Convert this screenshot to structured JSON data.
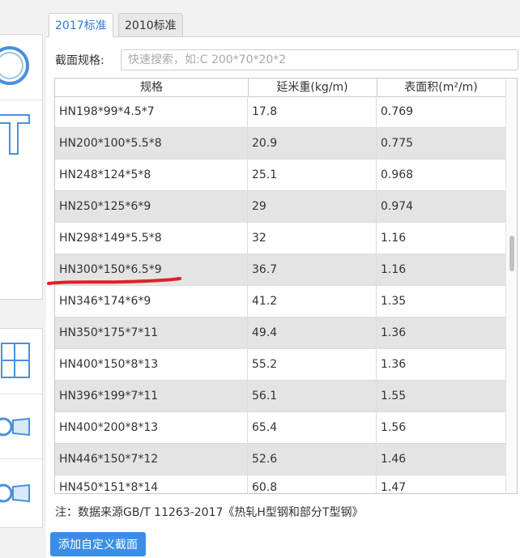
{
  "tabs": [
    {
      "label": "2017标准",
      "active": true
    },
    {
      "label": "2010标准",
      "active": false
    }
  ],
  "search": {
    "label": "截面规格:",
    "placeholder": "快速搜索，如:C 200*70*20*2",
    "value": ""
  },
  "table": {
    "headers": [
      "规格",
      "延米重(kg/m)",
      "表面积(m²/m)"
    ],
    "rows": [
      [
        "HN198*99*4.5*7",
        "17.8",
        "0.769"
      ],
      [
        "HN200*100*5.5*8",
        "20.9",
        "0.775"
      ],
      [
        "HN248*124*5*8",
        "25.1",
        "0.968"
      ],
      [
        "HN250*125*6*9",
        "29",
        "0.974"
      ],
      [
        "HN298*149*5.5*8",
        "32",
        "1.16"
      ],
      [
        "HN300*150*6.5*9",
        "36.7",
        "1.16"
      ],
      [
        "HN346*174*6*9",
        "41.2",
        "1.35"
      ],
      [
        "HN350*175*7*11",
        "49.4",
        "1.36"
      ],
      [
        "HN400*150*8*13",
        "55.2",
        "1.36"
      ],
      [
        "HN396*199*7*11",
        "56.1",
        "1.55"
      ],
      [
        "HN400*200*8*13",
        "65.4",
        "1.56"
      ],
      [
        "HN446*150*7*12",
        "52.6",
        "1.46"
      ],
      [
        "HN450*151*8*14",
        "60.8",
        "1.47"
      ]
    ]
  },
  "note": "注：数据来源GB/T 11263-2017《热轧H型钢和部分T型钢》",
  "add_button": "添加自定义截面",
  "colors": {
    "accent": "#3a8ee6",
    "tab_active": "#2e7bd6",
    "alt_row": "#e4e4e4",
    "annotation": "#e0202a"
  }
}
